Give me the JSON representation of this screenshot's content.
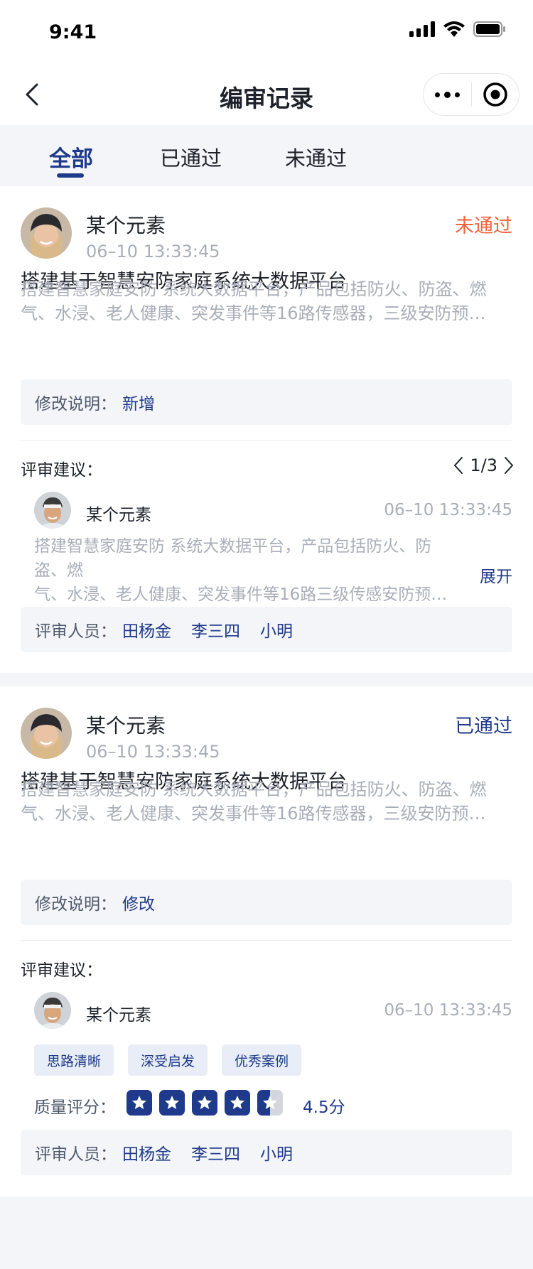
{
  "status_bar": {
    "time": "9:41"
  },
  "nav": {
    "title": "编审记录"
  },
  "tabs": [
    {
      "label": "全部",
      "active": true
    },
    {
      "label": "已通过",
      "active": false
    },
    {
      "label": "未通过",
      "active": false
    }
  ],
  "records": [
    {
      "author": "某个元素",
      "time": "06–10 13:33:45",
      "status": "未通过",
      "title": "搭建基于智慧安防家庭系统大数据平台",
      "desc_line1": "搭建智慧家庭安防 系统大数据平台，产品包括防火、防盗、燃",
      "desc_line2": "气、水浸、老人健康、突发事件等16路传感器，三级安防预…",
      "change_label": "修改说明：",
      "change_value": "新增",
      "review_label": "评审建议：",
      "pager": "1/3",
      "reviewer_name": "某个元素",
      "reviewer_time": "06–10 13:33:45",
      "review_line1": "搭建智慧家庭安防 系统大数据平台，产品包括防火、防盗、燃",
      "review_line2": "气、水浸、老人健康、突发事件等16路三级传感安防预…",
      "expand": "展开",
      "reviewers_label": "评审人员：",
      "reviewers": [
        "田杨金",
        "李三四",
        "小明"
      ]
    },
    {
      "author": "某个元素",
      "time": "06–10 13:33:45",
      "status": "已通过",
      "title": "搭建基于智慧安防家庭系统大数据平台",
      "desc_line1": "搭建智慧家庭安防 系统大数据平台，产品包括防火、防盗、燃",
      "desc_line2": "气、水浸、老人健康、突发事件等16路传感器，三级安防预…",
      "change_label": "修改说明：",
      "change_value": "修改",
      "review_label": "评审建议：",
      "reviewer_name": "某个元素",
      "reviewer_time": "06–10 13:33:45",
      "tags": [
        "思路清晰",
        "深受启发",
        "优秀案例"
      ],
      "rating_label": "质量评分：",
      "rating": 4.5,
      "rating_max": 5,
      "score": "4.5分",
      "reviewers_label": "评审人员：",
      "reviewers": [
        "田杨金",
        "李三四",
        "小明"
      ]
    }
  ],
  "colors": {
    "accent": "#1f3a8a",
    "fail": "#f5613c",
    "muted": "#a9aeb8",
    "background": "#f4f5f9"
  },
  "icons": [
    "back-arrow-icon",
    "more-dots-icon",
    "record-target-icon",
    "signal-icon",
    "wifi-icon",
    "battery-icon",
    "chevron-left-icon",
    "chevron-right-icon",
    "star-icon"
  ]
}
